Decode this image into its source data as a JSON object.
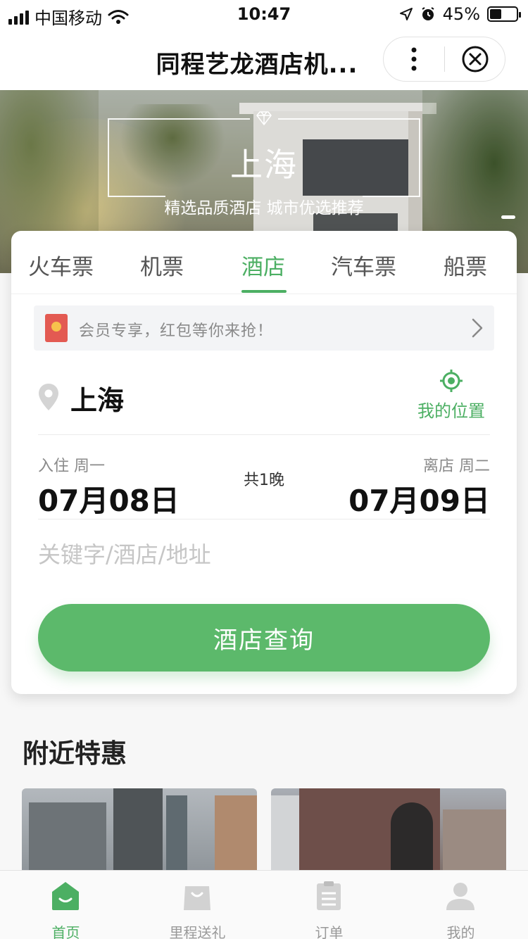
{
  "status_bar": {
    "carrier": "中国移动",
    "time": "10:47",
    "battery": "45%",
    "battery_level": 0.45
  },
  "nav": {
    "title": "同程艺龙酒店机..."
  },
  "banner": {
    "city": "上海",
    "slogan": "精选品质酒店 城市优选推荐"
  },
  "tabs": [
    {
      "label": "火车票"
    },
    {
      "label": "机票"
    },
    {
      "label": "酒店"
    },
    {
      "label": "汽车票"
    },
    {
      "label": "船票"
    }
  ],
  "active_tab": "酒店",
  "promo": {
    "text": "会员专享，红包等你来抢！"
  },
  "search": {
    "city": "上海",
    "locate_label": "我的位置",
    "checkin_label": "入住 周一",
    "checkin_date": "07月08日",
    "nights": "共1晚",
    "checkout_label": "离店 周二",
    "checkout_date": "07月09日",
    "keyword_placeholder": "关键字/酒店/地址",
    "keyword_value": "",
    "button_label": "酒店查询"
  },
  "nearby": {
    "title": "附近特惠"
  },
  "tabbar": [
    {
      "label": "首页",
      "icon": "home-icon",
      "active": true
    },
    {
      "label": "里程送礼",
      "icon": "gift-bag-icon",
      "active": false
    },
    {
      "label": "订单",
      "icon": "order-icon",
      "active": false
    },
    {
      "label": "我的",
      "icon": "profile-icon",
      "active": false
    }
  ],
  "colors": {
    "accent": "#4caf63",
    "button": "#5cb96b"
  }
}
